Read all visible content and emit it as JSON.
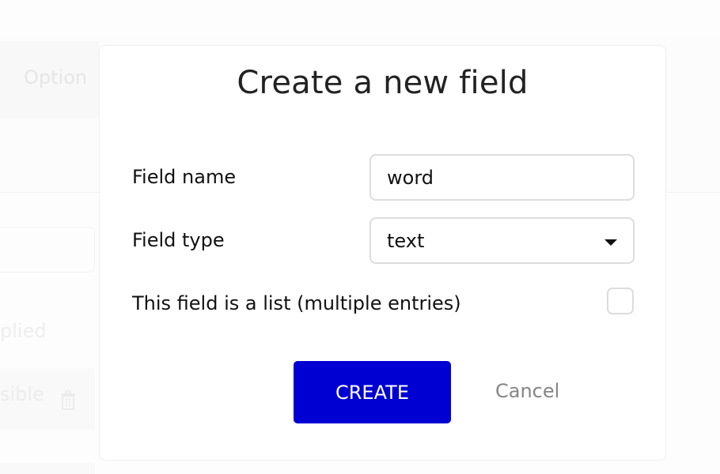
{
  "background": {
    "option_tab_label": "Option",
    "applied_label": "plied",
    "visible_label": "sible",
    "trash_icon": "trash-icon"
  },
  "modal": {
    "title": "Create a new field",
    "field_name": {
      "label": "Field name",
      "value": "word"
    },
    "field_type": {
      "label": "Field type",
      "selected": "text",
      "icon": "caret-down-icon"
    },
    "is_list": {
      "label": "This field is a list (multiple entries)",
      "checked": false
    },
    "buttons": {
      "create": "CREATE",
      "cancel": "Cancel"
    }
  },
  "colors": {
    "primary": "#0000d3",
    "cancel_text": "#858585",
    "border": "#dddddd"
  }
}
